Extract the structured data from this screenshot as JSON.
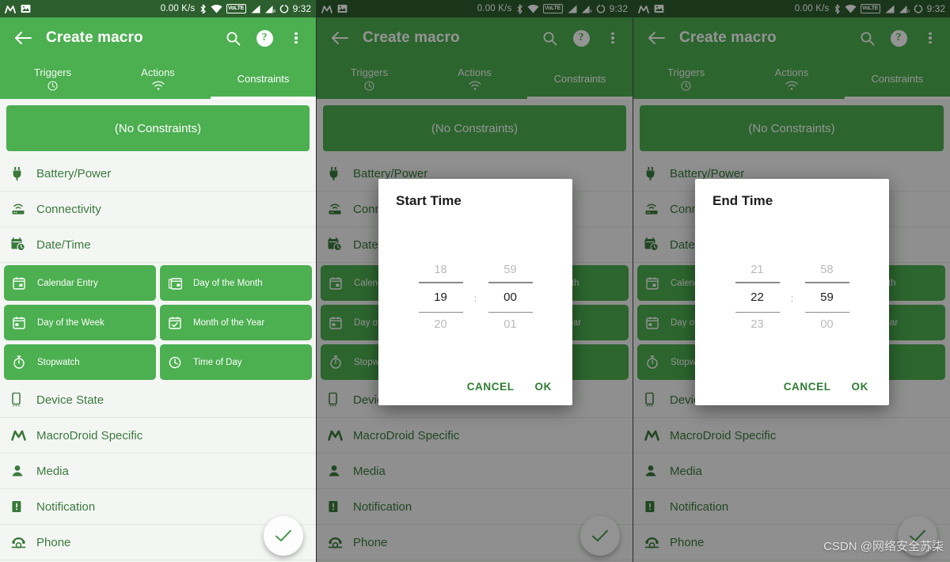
{
  "statusbar": {
    "left_icons": [
      "macrodroid-logo-icon",
      "image-icon"
    ],
    "network_speed": "0.00 K/s",
    "right_icons": [
      "bluetooth-icon",
      "wifi-icon",
      "volte-icon",
      "signal-bar-icon",
      "signal-bar-roaming-icon",
      "alarm-circle-icon"
    ],
    "volte_label": "VoLTE",
    "time": "9:32"
  },
  "appbar": {
    "back_label": "back-arrow",
    "title": "Create macro",
    "search_label": "search",
    "help_label": "?",
    "overflow_label": "more options"
  },
  "tabs": [
    {
      "label": "Triggers",
      "icon": "clock-icon",
      "active": false
    },
    {
      "label": "Actions",
      "icon": "wifi-icon",
      "active": false
    },
    {
      "label": "Constraints",
      "icon": "none",
      "active": true
    }
  ],
  "banner": {
    "label": "(No Constraints)"
  },
  "list": [
    {
      "label": "Battery/Power",
      "icon": "plug-icon"
    },
    {
      "label": "Connectivity",
      "icon": "router-icon"
    },
    {
      "label": "Date/Time",
      "icon": "calendar-clock-icon"
    }
  ],
  "chips": [
    {
      "label": "Calendar Entry",
      "icon": "calendar-entry-icon"
    },
    {
      "label": "Day of the Month",
      "icon": "calendar-stack-icon"
    },
    {
      "label": "Day of the Week",
      "icon": "calendar-week-icon"
    },
    {
      "label": "Month of the Year",
      "icon": "calendar-check-icon"
    },
    {
      "label": "Stopwatch",
      "icon": "stopwatch-icon"
    },
    {
      "label": "Time of Day",
      "icon": "clock-icon"
    }
  ],
  "list2": [
    {
      "label": "Device State",
      "icon": "phone-device-icon"
    },
    {
      "label": "MacroDroid Specific",
      "icon": "macrodroid-logo-icon"
    },
    {
      "label": "Media",
      "icon": "person-icon"
    },
    {
      "label": "Notification",
      "icon": "notification-exclamation-icon"
    },
    {
      "label": "Phone",
      "icon": "telephone-icon"
    }
  ],
  "fab": {
    "icon": "check-icon"
  },
  "dialogs": {
    "start": {
      "title": "Start Time",
      "hour": {
        "prev": "18",
        "selected": "19",
        "next": "20"
      },
      "minute": {
        "prev": "59",
        "selected": "00",
        "next": "01"
      },
      "separator": ":",
      "cancel_label": "CANCEL",
      "ok_label": "OK"
    },
    "end": {
      "title": "End Time",
      "hour": {
        "prev": "21",
        "selected": "22",
        "next": "23"
      },
      "minute": {
        "prev": "58",
        "selected": "59",
        "next": "00"
      },
      "separator": ":",
      "cancel_label": "CANCEL",
      "ok_label": "OK"
    }
  },
  "watermark": "CSDN @网络安全苏柒",
  "colors": {
    "primary_green": "#4caf50",
    "statusbar_green": "#2c5e2e",
    "text_green": "#3a7a3c",
    "dialog_action_green": "#2e7d32",
    "content_bg": "#f4f6f4",
    "scrim": "rgba(0,0,0,0.42)"
  }
}
